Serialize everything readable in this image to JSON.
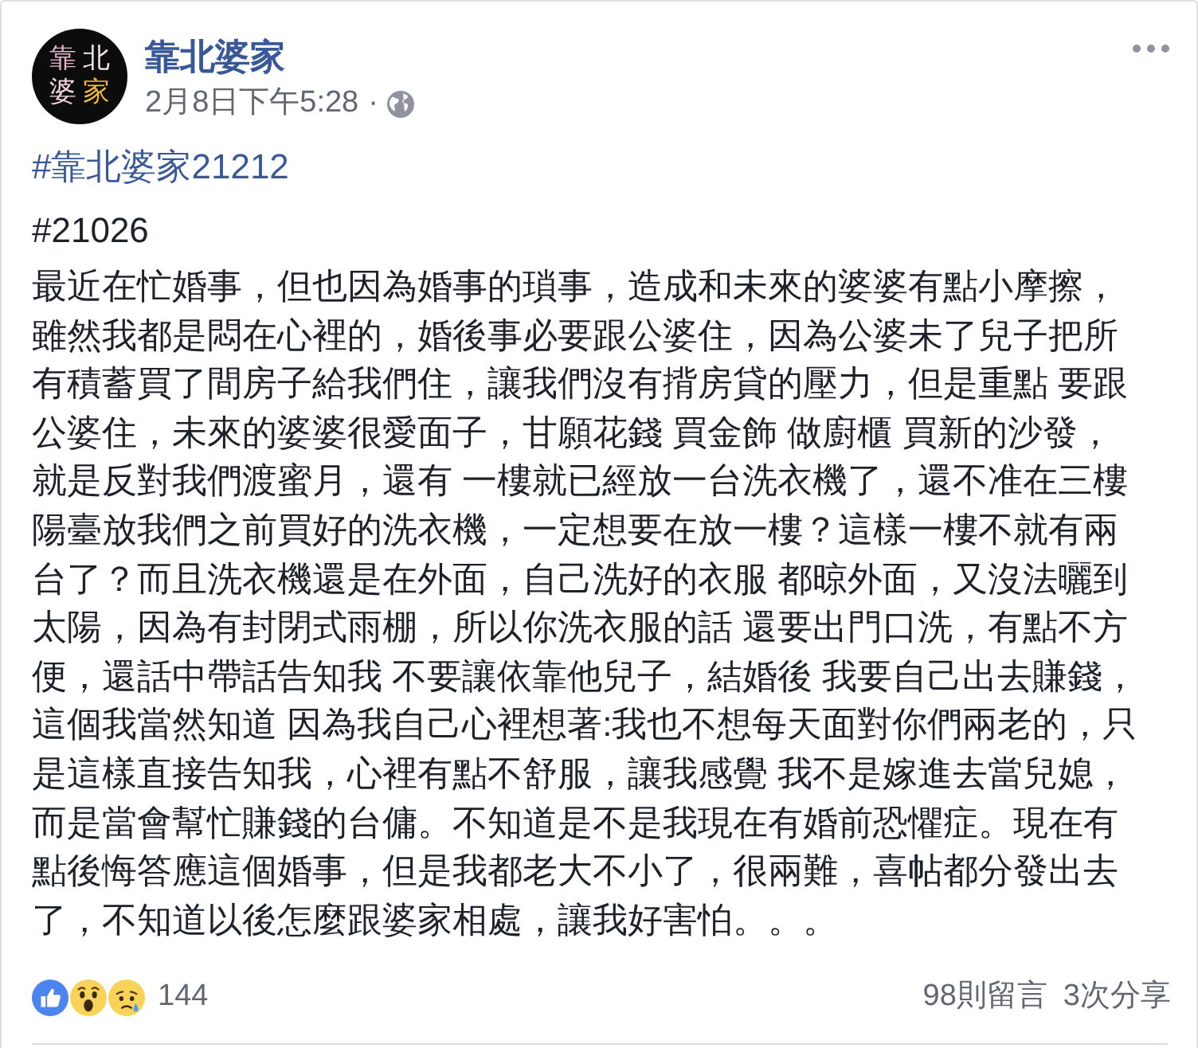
{
  "post": {
    "avatar": {
      "lines": [
        "靠北",
        "婆家"
      ]
    },
    "author": "靠北婆家",
    "timestamp": "2月8日下午5:28",
    "separator": "·"
  },
  "hashtag": "#靠北婆家21212",
  "post_number": "#21026",
  "body": "最近在忙婚事，但也因為婚事的瑣事，造成和未來的婆婆有點小摩擦，雖然我都是悶在心裡的，婚後事必要跟公婆住，因為公婆未了兒子把所有積蓄買了間房子給我們住，讓我們沒有揹房貸的壓力，但是重點 要跟公婆住，未來的婆婆很愛面子，甘願花錢 買金飾 做廚櫃 買新的沙發，就是反對我們渡蜜月，還有 一樓就已經放一台洗衣機了，還不准在三樓陽臺放我們之前買好的洗衣機，一定想要在放一樓？這樣一樓不就有兩台了？而且洗衣機還是在外面，自己洗好的衣服 都晾外面，又沒法曬到太陽，因為有封閉式雨棚，所以你洗衣服的話 還要出門口洗，有點不方便，還話中帶話告知我 不要讓依靠他兒子，結婚後 我要自己出去賺錢，這個我當然知道 因為我自己心裡想著:我也不想每天面對你們兩老的，只是這樣直接告知我，心裡有點不舒服，讓我感覺 我不是嫁進去當兒媳，而是當會幫忙賺錢的台傭。不知道是不是我現在有婚前恐懼症。現在有點後悔答應這個婚事，但是我都老大不小了，很兩難，喜帖都分發出去了，不知道以後怎麼跟婆家相處，讓我好害怕。。。",
  "footer": {
    "reactions": [
      {
        "kind": "like"
      },
      {
        "kind": "wow"
      },
      {
        "kind": "sad"
      }
    ],
    "reaction_count": "144",
    "comments": "98則留言",
    "shares": "3次分享"
  }
}
